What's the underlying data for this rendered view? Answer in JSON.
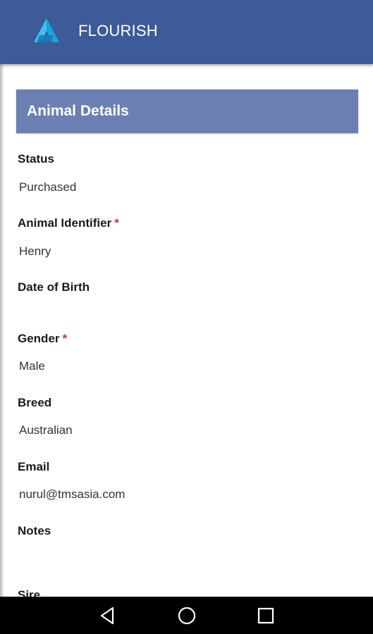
{
  "app": {
    "title": "FLOURISH"
  },
  "section": {
    "title": "Animal Details"
  },
  "fields": {
    "status": {
      "label": "Status",
      "value": "Purchased"
    },
    "animal_identifier": {
      "label": "Animal Identifier",
      "required_mark": "*",
      "value": "Henry"
    },
    "date_of_birth": {
      "label": "Date of Birth",
      "value": ""
    },
    "gender": {
      "label": "Gender",
      "required_mark": "*",
      "value": "Male"
    },
    "breed": {
      "label": "Breed",
      "value": "Australian"
    },
    "email": {
      "label": "Email",
      "value": "nurul@tmsasia.com"
    },
    "notes": {
      "label": "Notes",
      "value": ""
    },
    "sire": {
      "label": "Sire"
    }
  },
  "navigation": {
    "icons": [
      "back-icon",
      "home-icon",
      "recents-icon"
    ]
  },
  "colors": {
    "appbar": "#3d5a99",
    "section_header": "#6a80b3",
    "required": "#d32f2f",
    "navbar": "#000000"
  }
}
